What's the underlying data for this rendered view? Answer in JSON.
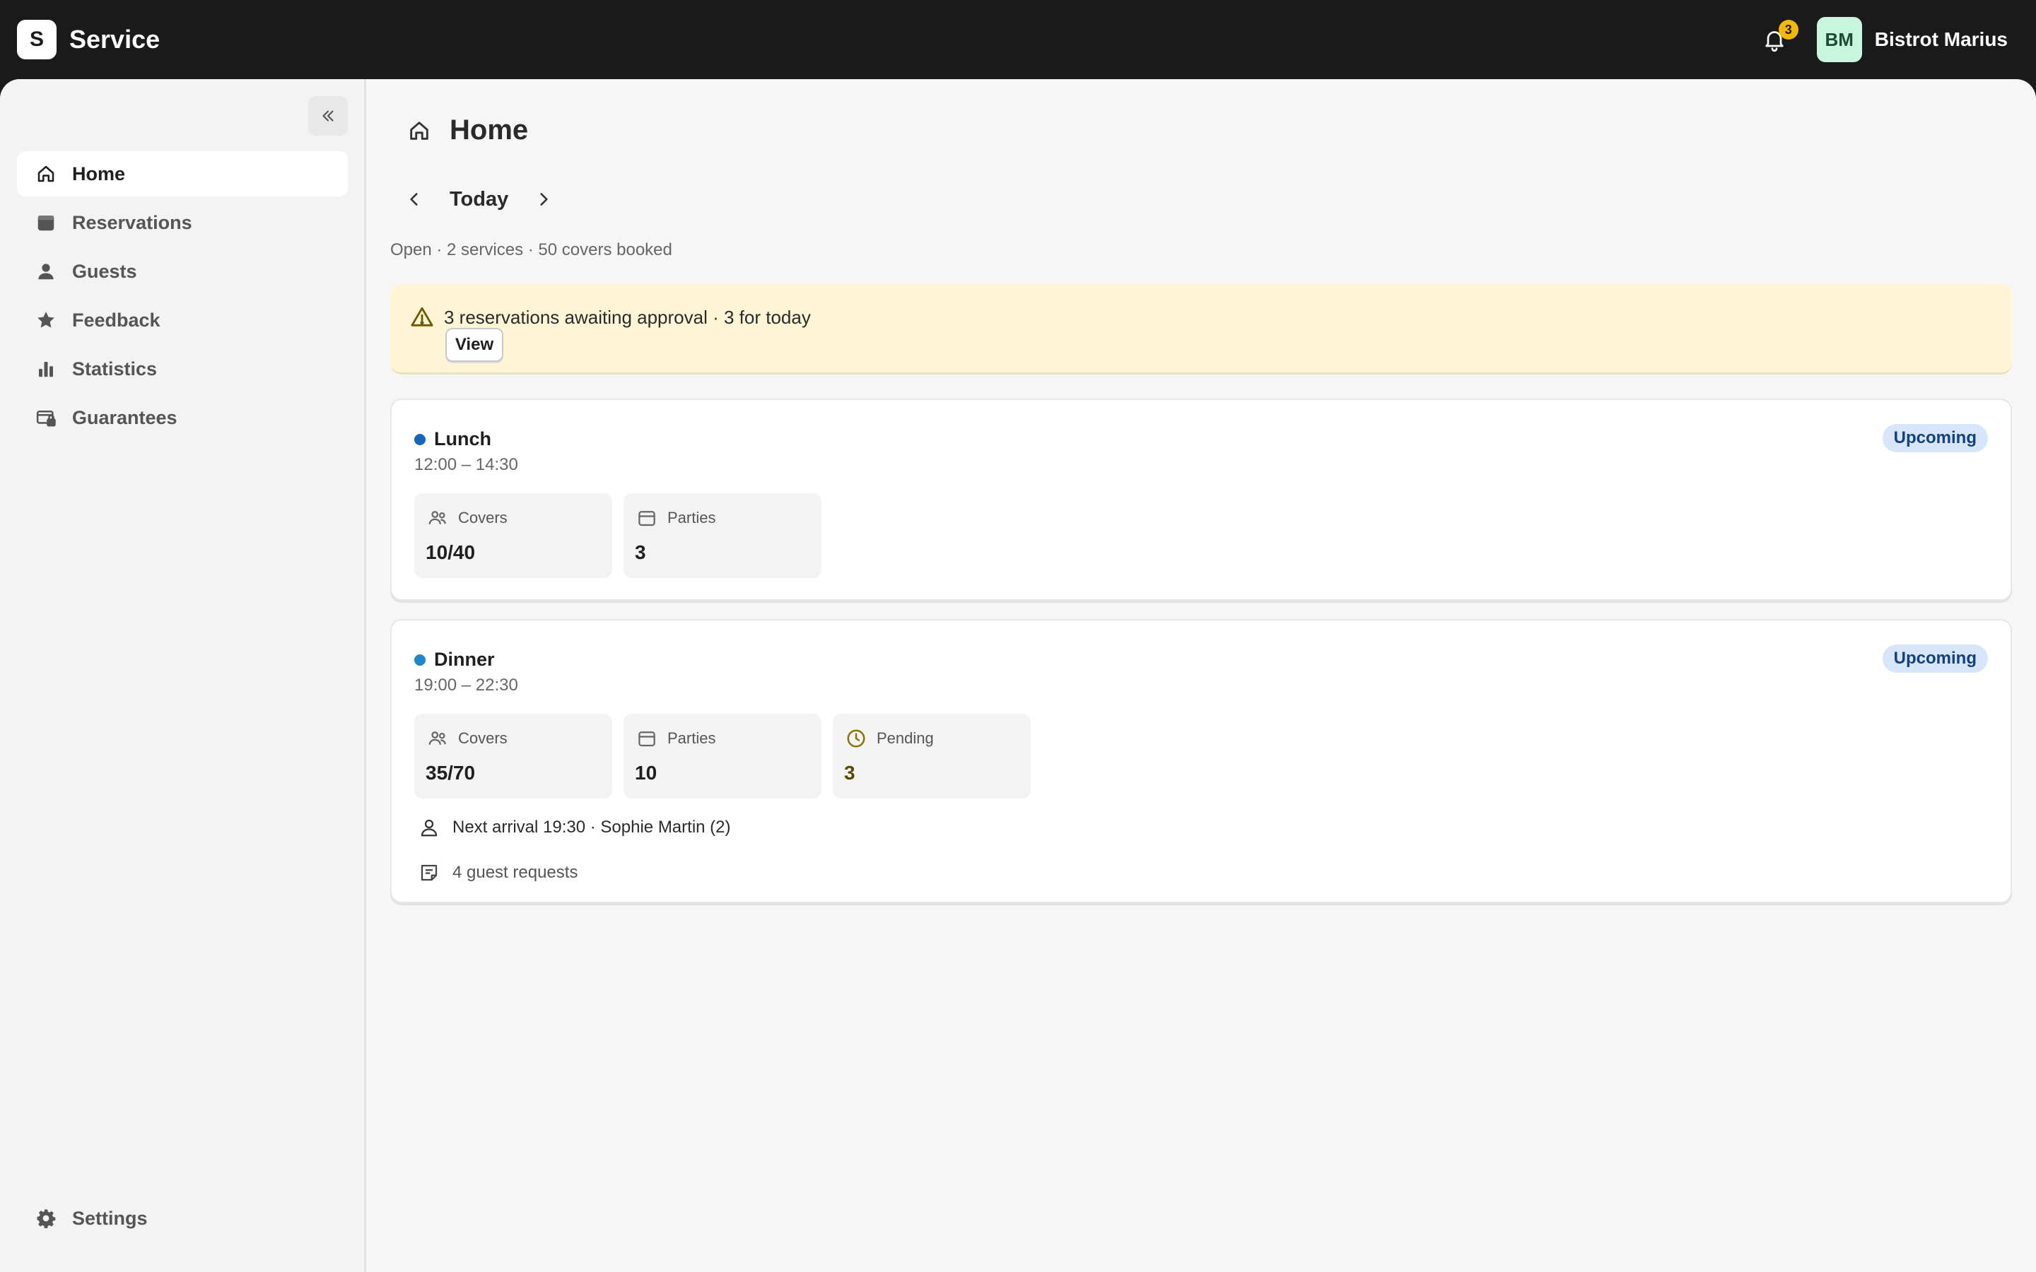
{
  "app": {
    "logo_letter": "S",
    "name": "Service"
  },
  "topbar": {
    "notification_count": "3",
    "avatar_initials": "BM",
    "account_name": "Bistrot Marius"
  },
  "sidebar": {
    "items": [
      {
        "label": "Home",
        "icon": "home-icon",
        "active": true
      },
      {
        "label": "Reservations",
        "icon": "calendar-icon"
      },
      {
        "label": "Guests",
        "icon": "person-icon"
      },
      {
        "label": "Feedback",
        "icon": "star-icon"
      },
      {
        "label": "Statistics",
        "icon": "bar-chart-icon"
      },
      {
        "label": "Guarantees",
        "icon": "card-lock-icon"
      }
    ],
    "settings_label": "Settings"
  },
  "page": {
    "title": "Home",
    "date_label": "Today",
    "summary": "Open · 2 services · 50 covers booked"
  },
  "alert": {
    "text": "3 reservations awaiting approval · 3 for today",
    "button_label": "View"
  },
  "services": [
    {
      "name": "Lunch",
      "time": "12:00 – 14:30",
      "status": "Upcoming",
      "dot_color": "#1565c0",
      "stats": [
        {
          "label": "Covers",
          "value": "10/40"
        },
        {
          "label": "Parties",
          "value": "3"
        }
      ]
    },
    {
      "name": "Dinner",
      "time": "19:00 – 22:30",
      "status": "Upcoming",
      "dot_color": "#1e88c9",
      "stats": [
        {
          "label": "Covers",
          "value": "35/70"
        },
        {
          "label": "Parties",
          "value": "10"
        },
        {
          "label": "Pending",
          "value": "3"
        }
      ],
      "next_arrival": "Next arrival 19:30 · Sophie Martin (2)",
      "guest_requests": "4 guest requests"
    }
  ],
  "colors": {
    "topbar": "#1a1a1a",
    "badge": "#f5b800",
    "avatar_bg": "#c9f5de",
    "alert_bg": "#fdf5d6",
    "status_bg": "#d7e6fb",
    "pending_icon": "#8a7300"
  }
}
